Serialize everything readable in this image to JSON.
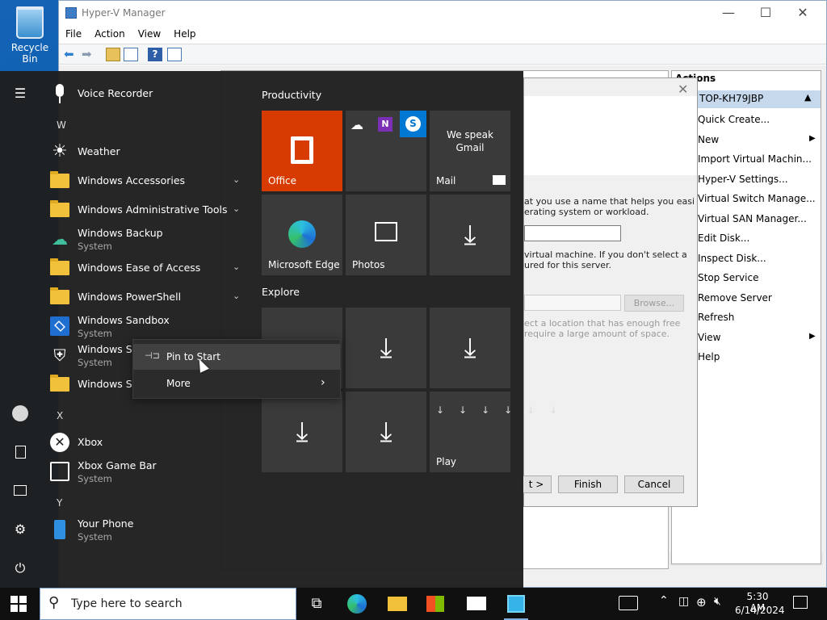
{
  "desktop": {
    "recycle_bin": "Recycle Bin"
  },
  "hyperv": {
    "title": "Hyper-V Manager",
    "menu": [
      "File",
      "Action",
      "View",
      "Help"
    ],
    "actions": {
      "header": "Actions",
      "host": "TOP-KH79JBP",
      "items": [
        "Quick Create...",
        "New",
        "Import Virtual Machin...",
        "Hyper-V Settings...",
        "Virtual Switch Manage...",
        "Virtual SAN Manager...",
        "Edit Disk...",
        "Inspect Disk...",
        "Stop Service",
        "Remove Server",
        "Refresh",
        "View",
        "Help"
      ]
    }
  },
  "wizard": {
    "text1": "at you use a name that helps you easily\nerating system or workload.",
    "text2": "virtual machine. If you don't select a\nured for this server.",
    "browse": "Browse...",
    "note": "ect a location that has enough free\nrequire a large amount of space.",
    "next": "t >",
    "finish": "Finish",
    "cancel": "Cancel"
  },
  "start": {
    "apps": [
      {
        "name": "Voice Recorder"
      },
      {
        "letter": "W"
      },
      {
        "name": "Weather"
      },
      {
        "name": "Windows Accessories"
      },
      {
        "name": "Windows Administrative Tools"
      },
      {
        "name": "Windows Backup",
        "sub": "System"
      },
      {
        "name": "Windows Ease of Access"
      },
      {
        "name": "Windows PowerShell"
      },
      {
        "name": "Windows Sandbox",
        "sub": "System"
      },
      {
        "name": "Windows Sec",
        "sub": "System"
      },
      {
        "name": "Windows Sys"
      },
      {
        "letter": "X"
      },
      {
        "name": "Xbox"
      },
      {
        "name": "Xbox Game Bar",
        "sub": "System"
      },
      {
        "letter": "Y"
      },
      {
        "name": "Your Phone",
        "sub": "System"
      }
    ],
    "groups": [
      "Productivity",
      "Explore"
    ],
    "tiles": {
      "office": "Office",
      "mail": "Mail",
      "mail_tag": "We speak\nGmail",
      "edge": "Microsoft Edge",
      "photos": "Photos",
      "play": "Play"
    }
  },
  "context_menu": {
    "pin": "Pin to Start",
    "more": "More"
  },
  "taskbar": {
    "search_placeholder": "Type here to search",
    "time": "5:30 AM",
    "date": "6/14/2024"
  },
  "colors": {
    "office": "#d83b01",
    "accent": "#0078d4",
    "skype": "#0078d4"
  }
}
